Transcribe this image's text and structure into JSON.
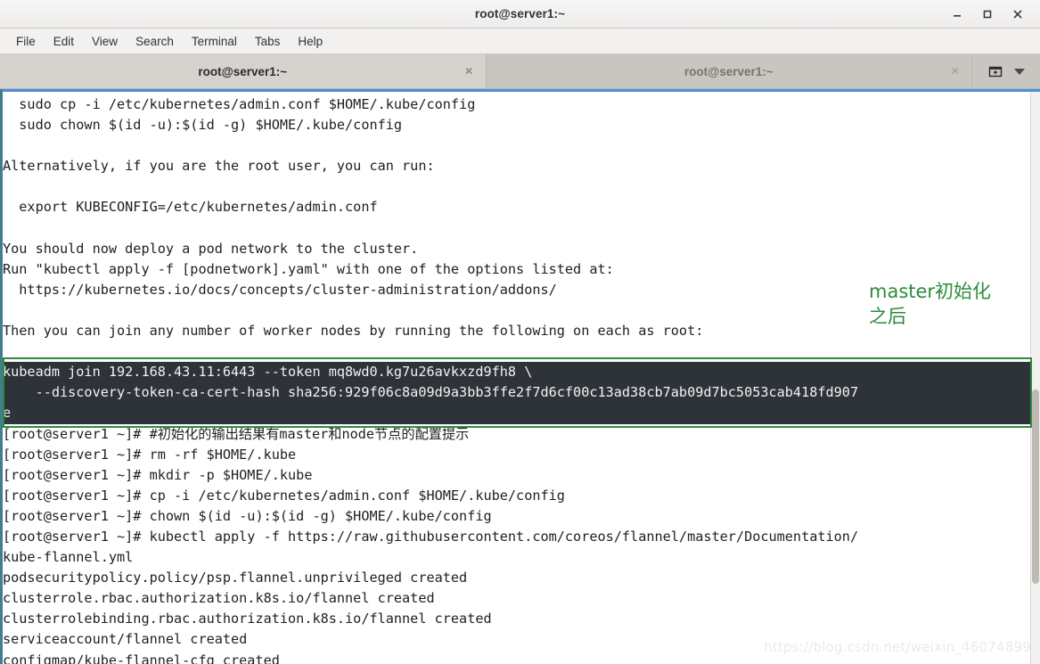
{
  "window": {
    "title": "root@server1:~",
    "controls": {
      "minimize": "minimize-button",
      "maximize": "maximize-button",
      "close": "close-button"
    }
  },
  "menubar": {
    "items": [
      {
        "label": "File"
      },
      {
        "label": "Edit"
      },
      {
        "label": "View"
      },
      {
        "label": "Search"
      },
      {
        "label": "Terminal"
      },
      {
        "label": "Tabs"
      },
      {
        "label": "Help"
      }
    ]
  },
  "tabs": {
    "items": [
      {
        "label": "root@server1:~",
        "active": true,
        "close": "×"
      },
      {
        "label": "root@server1:~",
        "active": false,
        "close": "×"
      }
    ],
    "new_tab_icon": "new-tab-icon",
    "menu_arrow_icon": "chevron-down-icon"
  },
  "terminal": {
    "lines_before_selection": [
      "  sudo cp -i /etc/kubernetes/admin.conf $HOME/.kube/config",
      "  sudo chown $(id -u):$(id -g) $HOME/.kube/config",
      "",
      "Alternatively, if you are the root user, you can run:",
      "",
      "  export KUBECONFIG=/etc/kubernetes/admin.conf",
      "",
      "You should now deploy a pod network to the cluster.",
      "Run \"kubectl apply -f [podnetwork].yaml\" with one of the options listed at:",
      "  https://kubernetes.io/docs/concepts/cluster-administration/addons/",
      "",
      "Then you can join any number of worker nodes by running the following on each as root:",
      ""
    ],
    "selection": [
      "kubeadm join 192.168.43.11:6443 --token mq8wd0.kg7u26avkxzd9fh8 \\",
      "    --discovery-token-ca-cert-hash sha256:929f06c8a09d9a3bb3ffe2f7d6cf00c13ad38cb7ab09d7bc5053cab418fd907",
      "e"
    ],
    "lines_after_selection": [
      "[root@server1 ~]# #初始化的输出结果有master和node节点的配置提示",
      "[root@server1 ~]# rm -rf $HOME/.kube",
      "[root@server1 ~]# mkdir -p $HOME/.kube",
      "[root@server1 ~]# cp -i /etc/kubernetes/admin.conf $HOME/.kube/config",
      "[root@server1 ~]# chown $(id -u):$(id -g) $HOME/.kube/config",
      "[root@server1 ~]# kubectl apply -f https://raw.githubusercontent.com/coreos/flannel/master/Documentation/",
      "kube-flannel.yml",
      "podsecuritypolicy.policy/psp.flannel.unprivileged created",
      "clusterrole.rbac.authorization.k8s.io/flannel created",
      "clusterrolebinding.rbac.authorization.k8s.io/flannel created",
      "serviceaccount/flannel created",
      "configmap/kube-flannel-cfg created"
    ]
  },
  "annotation": {
    "line1": "master初始化",
    "line2": "之后",
    "color": "#2e8b3d"
  },
  "highlight_box": {
    "color": "#2e8b3d"
  },
  "watermark": {
    "text": "https://blog.csdn.net/weixin_46074899"
  },
  "colors": {
    "terminal_bg": "#ffffff",
    "terminal_fg": "#1d1f21",
    "selection_bg": "#2d3338",
    "selection_fg": "#f2f2f2",
    "window_chrome": "#f2f1f0",
    "tab_active": "#d6d3ce",
    "tab_inactive": "#c9c6c1",
    "accent_blue": "#4a90d9",
    "window_edge": "#3f7f8f"
  }
}
